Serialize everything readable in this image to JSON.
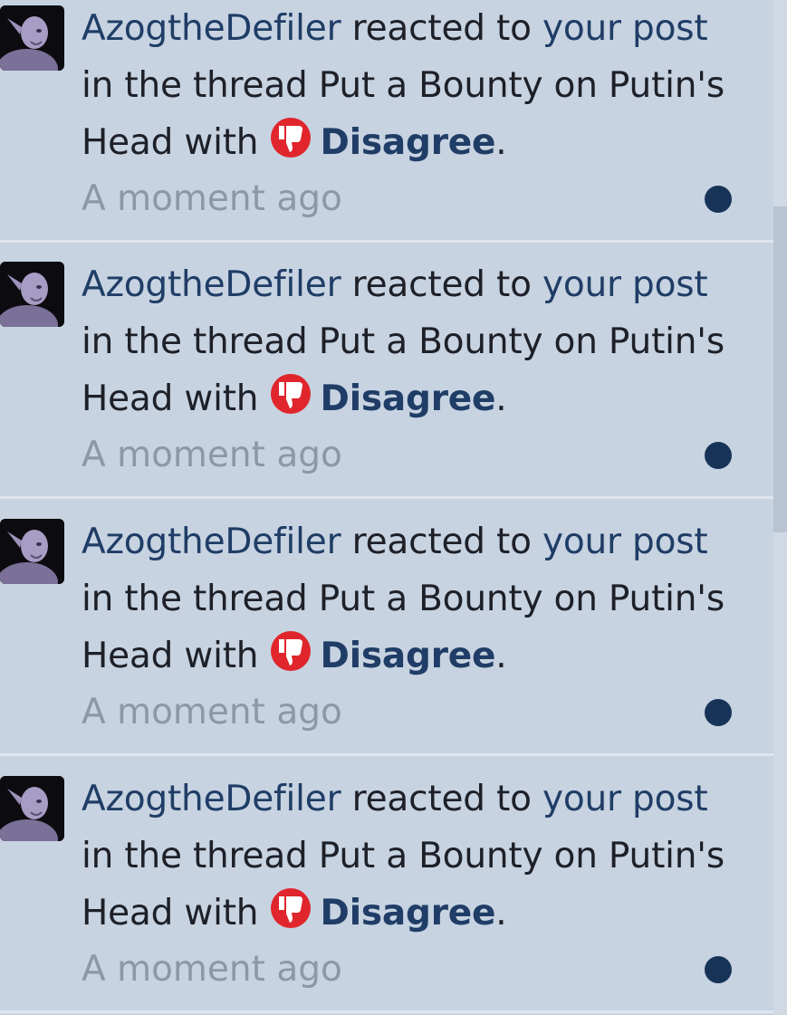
{
  "notifications": [
    {
      "user": "AzogtheDefiler",
      "t1": " reacted to ",
      "link": "your post",
      "t2": " in the thread Put a Bounty on Putin's Head with ",
      "reaction": "Disagree",
      "period": ".",
      "time": "A moment ago"
    },
    {
      "user": "AzogtheDefiler",
      "t1": " reacted to ",
      "link": "your post",
      "t2": " in the thread Put a Bounty on Putin's Head with ",
      "reaction": "Disagree",
      "period": ".",
      "time": "A moment ago"
    },
    {
      "user": "AzogtheDefiler",
      "t1": " reacted to ",
      "link": "your post",
      "t2": " in the thread Put a Bounty on Putin's Head with ",
      "reaction": "Disagree",
      "period": ".",
      "time": "A moment ago"
    },
    {
      "user": "AzogtheDefiler",
      "t1": " reacted to ",
      "link": "your post",
      "t2": " in the thread Put a Bounty on Putin's Head with ",
      "reaction": "Disagree",
      "period": ".",
      "time": "A moment ago"
    }
  ],
  "colors": {
    "background": "#c7d3e1",
    "link": "#1f3d66",
    "unread_dot": "#173458",
    "reaction_icon": "#e0262c",
    "timestamp": "#8c98a8"
  },
  "icons": {
    "reaction": "thumbs-down-icon",
    "unread": "unread-dot-icon"
  }
}
